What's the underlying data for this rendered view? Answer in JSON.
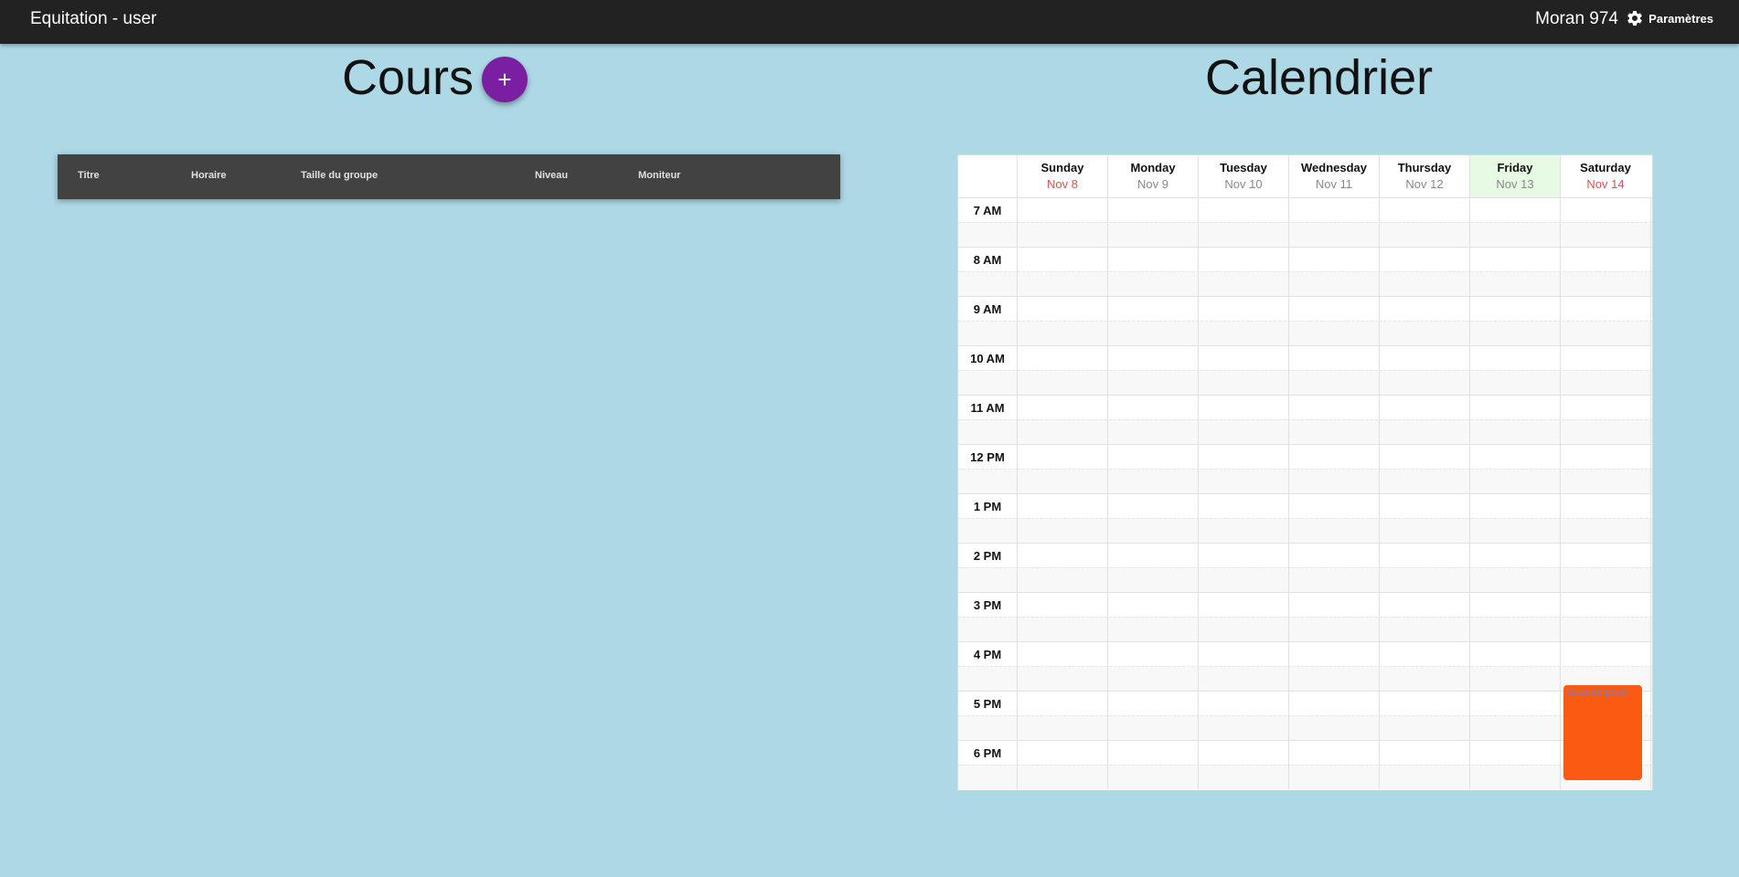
{
  "header": {
    "app_title": "Equitation - user",
    "user_name": "Moran 974",
    "settings_label": "Paramètres",
    "settings_icon": "gear-icon"
  },
  "courses": {
    "title": "Cours",
    "add_button_label": "+",
    "columns": [
      "Titre",
      "Horaire",
      "Taille du groupe",
      "Niveau",
      "Moniteur"
    ],
    "rows": []
  },
  "calendar": {
    "title": "Calendrier",
    "days": [
      {
        "name": "Sunday",
        "date": "Nov 8",
        "weekend": true,
        "today": false
      },
      {
        "name": "Monday",
        "date": "Nov 9",
        "weekend": false,
        "today": false
      },
      {
        "name": "Tuesday",
        "date": "Nov 10",
        "weekend": false,
        "today": false
      },
      {
        "name": "Wednesday",
        "date": "Nov 11",
        "weekend": false,
        "today": false
      },
      {
        "name": "Thursday",
        "date": "Nov 12",
        "weekend": false,
        "today": false
      },
      {
        "name": "Friday",
        "date": "Nov 13",
        "weekend": false,
        "today": true
      },
      {
        "name": "Saturday",
        "date": "Nov 14",
        "weekend": true,
        "today": false
      }
    ],
    "times": [
      "7 AM",
      "8 AM",
      "9 AM",
      "10 AM",
      "11 AM",
      "12 PM",
      "1 PM",
      "2 PM",
      "3 PM",
      "4 PM",
      "5 PM",
      "6 PM"
    ],
    "today_color": "#e7fbe4",
    "weekend_date_color": "#d9534f",
    "events": [
      {
        "title": "cours de plouk",
        "day": "Saturday",
        "start": "4:45 PM",
        "end": "6:45 PM",
        "color": "#f95b12"
      }
    ]
  },
  "colors": {
    "page_background": "#add8e6",
    "topbar": "#222222",
    "add_button": "#7b1fa2",
    "table_header": "#424242"
  }
}
